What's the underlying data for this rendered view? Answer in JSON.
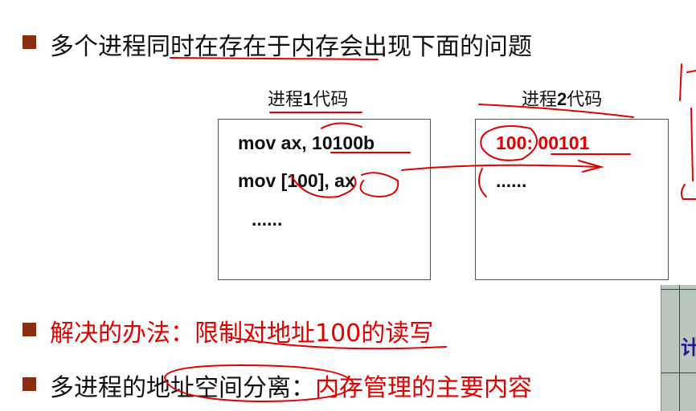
{
  "slide": {
    "bullet1": "多个进程同时在存在于内存会出现下面的问题",
    "process1": {
      "label_prefix": "进程",
      "label_num": "1",
      "label_suffix": "代码",
      "lines": [
        "mov ax, 10100b",
        "mov [100], ax",
        "......"
      ]
    },
    "process2": {
      "label_prefix": "进程",
      "label_num": "2",
      "label_suffix": "代码",
      "lines": [
        "100: 00101",
        "......"
      ]
    },
    "bullet2": "解决的办法：限制对地址100的读写",
    "bullet3_black": "多进程的地址空间分离：",
    "bullet3_red": "内存管理的主要内容",
    "photo_char": "计"
  },
  "colors": {
    "bullet": "#8a2e12",
    "red_text": "#e00000",
    "ink": "#e00000"
  }
}
